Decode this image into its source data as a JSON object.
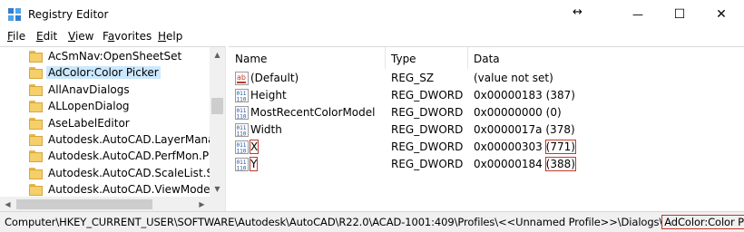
{
  "window": {
    "title": "Registry Editor",
    "resize_glyph": "↔",
    "buttons": {
      "minimize": "—",
      "maximize": "☐",
      "close": "✕"
    }
  },
  "menu": [
    "File",
    "Edit",
    "View",
    "Favorites",
    "Help"
  ],
  "menu_underline": [
    "F",
    "E",
    "V",
    "a",
    "H"
  ],
  "tree": {
    "items": [
      {
        "label": "AcSmNav:OpenSheetSet",
        "selected": false
      },
      {
        "label": "AdColor:Color Picker",
        "selected": true
      },
      {
        "label": "AllAnavDialogs",
        "selected": false
      },
      {
        "label": "ALLopenDialog",
        "selected": false
      },
      {
        "label": "AseLabelEditor",
        "selected": false
      },
      {
        "label": "Autodesk.AutoCAD.LayerManage",
        "selected": false
      },
      {
        "label": "Autodesk.AutoCAD.PerfMon.PmS",
        "selected": false
      },
      {
        "label": "Autodesk.AutoCAD.ScaleList.Scale",
        "selected": false
      },
      {
        "label": "Autodesk.AutoCAD.ViewModel.Sy",
        "selected": false
      }
    ]
  },
  "values": {
    "headers": {
      "name": "Name",
      "type": "Type",
      "data": "Data"
    },
    "rows": [
      {
        "icon": "string-value-icon",
        "name": "(Default)",
        "type": "REG_SZ",
        "data": "(value not set)",
        "data_hex": "",
        "data_dec": "",
        "highlight": false
      },
      {
        "icon": "binary-value-icon",
        "name": "Height",
        "type": "REG_DWORD",
        "data": "",
        "data_hex": "0x00000183",
        "data_dec": "(387)",
        "highlight": false
      },
      {
        "icon": "binary-value-icon",
        "name": "MostRecentColorModel",
        "type": "REG_DWORD",
        "data": "",
        "data_hex": "0x00000000",
        "data_dec": "(0)",
        "highlight": false
      },
      {
        "icon": "binary-value-icon",
        "name": "Width",
        "type": "REG_DWORD",
        "data": "",
        "data_hex": "0x0000017a",
        "data_dec": "(378)",
        "highlight": false
      },
      {
        "icon": "binary-value-icon",
        "name": "X",
        "type": "REG_DWORD",
        "data": "",
        "data_hex": "0x00000303",
        "data_dec": "(771)",
        "highlight": true
      },
      {
        "icon": "binary-value-icon",
        "name": "Y",
        "type": "REG_DWORD",
        "data": "",
        "data_hex": "0x00000184",
        "data_dec": "(388)",
        "highlight": true
      }
    ]
  },
  "status": {
    "path_prefix": "Computer\\HKEY_CURRENT_USER\\SOFTWARE\\Autodesk\\AutoCAD\\R22.0\\ACAD-1001:409\\Profiles\\<<Unnamed Profile>>\\Dialogs\\",
    "path_key": "AdColor:Color Picker"
  },
  "colors": {
    "selection": "#cce8ff",
    "highlight_box": "#c0392b",
    "folder": "#f4cf6a"
  }
}
